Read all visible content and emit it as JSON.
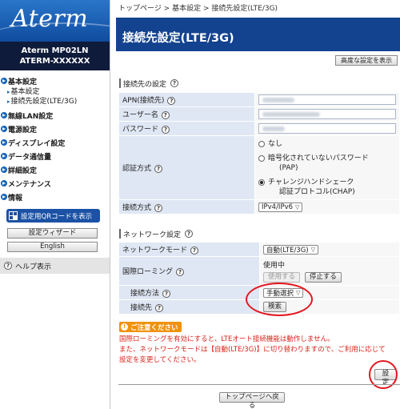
{
  "brand": {
    "logo_text": "Aterm",
    "model_line1": "Aterm   MP02LN",
    "model_line2": "ATERM-XXXXXX"
  },
  "sidebar": {
    "sections": [
      {
        "label": "基本設定",
        "children": [
          "基本設定",
          "接続先設定(LTE/3G)"
        ]
      },
      {
        "label": "無線LAN設定"
      },
      {
        "label": "電源設定"
      },
      {
        "label": "ディスプレイ設定"
      },
      {
        "label": "データ通信量"
      },
      {
        "label": "詳細設定"
      },
      {
        "label": "メンテナンス"
      },
      {
        "label": "情報"
      }
    ],
    "qr_button": "設定用QRコードを表示",
    "wizard_button": "設定ウィザード",
    "english_button": "English",
    "help_link": "ヘルプ表示"
  },
  "breadcrumb": "トップページ > 基本設定 > 接続先設定(LTE/3G)",
  "page_title": "接続先設定(LTE/3G)",
  "advanced_button": "高度な設定を表示",
  "connection_section": {
    "heading": "接続先の設定",
    "apn_label": "APN(接続先)",
    "apn_value": "cmknk",
    "user_label": "ユーザー名",
    "user_value": "nnnnnf-xxx-xxxxxx",
    "password_label": "パスワード",
    "password_value": "xxxxx",
    "auth_label": "認証方式",
    "auth_options": [
      "なし",
      "暗号化されていないパスワード",
      "(PAP)",
      "チャレンジハンドシェーク",
      "認証プロトコル(CHAP)"
    ],
    "auth_selected": "CHAP",
    "conn_type_label": "接続方式",
    "conn_type_value": "IPv4/IPv6"
  },
  "network_section": {
    "heading": "ネットワーク設定",
    "network_mode_label": "ネットワークモード",
    "network_mode_value": "自動(LTE/3G)",
    "roaming_label": "国際ローミング",
    "roaming_status": "使用中",
    "roaming_use_button": "使用する",
    "roaming_stop_button": "停止する",
    "connect_method_label": "接続方法",
    "connect_method_value": "手動選択",
    "connect_dest_label": "接続先",
    "search_button": "検索"
  },
  "caution": {
    "badge": "ご注意ください",
    "line1": "国際ローミングを有効にすると、LTEオート接続機能は動作しません。",
    "line2": "また、ネットワークモードは【自動(LTE/3G)】に切り替わりますので、ご利用に応じて",
    "line3": "設定を変更してください。"
  },
  "set_button": "設定",
  "top_page_button": "トップページへ戻る",
  "colors": {
    "brand_blue": "#13428f",
    "highlight_red": "#e3171f",
    "caution_orange": "#f0920b",
    "warning_text": "#d8231b"
  }
}
